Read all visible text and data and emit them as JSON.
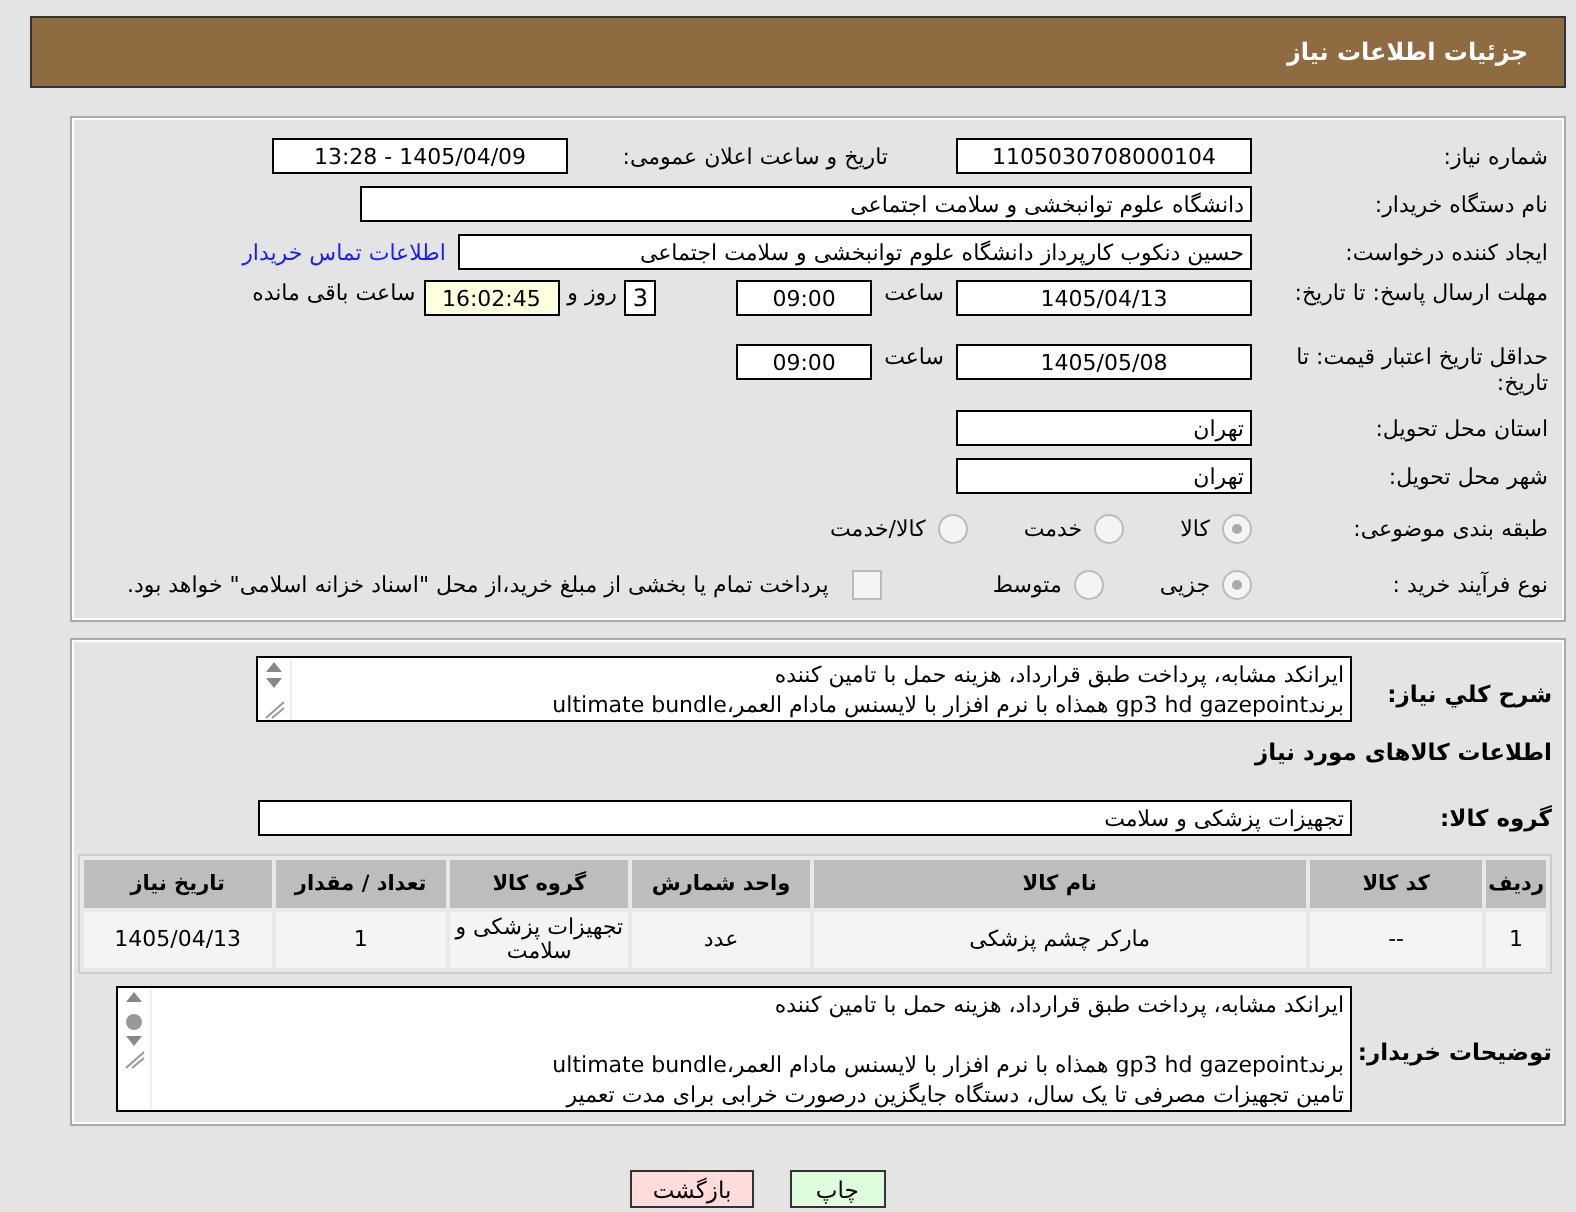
{
  "header": {
    "title": "جزئیات اطلاعات نیاز"
  },
  "need_number": {
    "label": "شماره نیاز:",
    "value": "1105030708000104"
  },
  "announce": {
    "label": "تاریخ و ساعت اعلان عمومی:",
    "value": "1405/04/09 - 13:28"
  },
  "buyer_org": {
    "label": "نام دستگاه خریدار:",
    "value": "دانشگاه علوم توانبخشی و سلامت اجتماعی"
  },
  "requester": {
    "label": "ایجاد کننده درخواست:",
    "value": "حسین دنکوب کارپرداز دانشگاه علوم توانبخشی و سلامت اجتماعی",
    "link": "اطلاعات تماس خریدار"
  },
  "response_deadline": {
    "label": "مهلت ارسال پاسخ: تا تاریخ:",
    "date": "1405/04/13",
    "time_label": "ساعت",
    "time": "09:00",
    "days": "3",
    "days_label": "روز و",
    "remaining": "16:02:45",
    "remaining_label": "ساعت باقی مانده"
  },
  "price_validity": {
    "label": "حداقل تاریخ اعتبار قیمت: تا تاریخ:",
    "date": "1405/05/08",
    "time_label": "ساعت",
    "time": "09:00"
  },
  "province": {
    "label": "استان محل تحویل:",
    "value": "تهران"
  },
  "city": {
    "label": "شهر محل تحویل:",
    "value": "تهران"
  },
  "category": {
    "label": "طبقه بندی موضوعی:",
    "options": [
      {
        "label": "کالا",
        "selected": true
      },
      {
        "label": "خدمت",
        "selected": false
      },
      {
        "label": "کالا/خدمت",
        "selected": false
      }
    ]
  },
  "process": {
    "label": "نوع فرآیند خرید :",
    "options": [
      {
        "label": "جزیی",
        "selected": true
      },
      {
        "label": "متوسط",
        "selected": false
      }
    ],
    "payment": {
      "label": "پرداخت تمام یا بخشی از مبلغ خرید،از محل \"اسناد خزانه اسلامی\" خواهد بود.",
      "checked": false
    }
  },
  "description": {
    "label": "شرح کلي نياز:",
    "lines": [
      "ایرانکد مشابه، پرداخت طبق قرارداد، هزینه حمل با تامین کننده",
      "برندgp3 hd gazepoint همذاه با نرم افزار با لایسنس مادام العمر،ultimate bundle"
    ]
  },
  "goods_title": "اطلاعات کالاهای مورد نیاز",
  "goods_group": {
    "label": "گروه کالا:",
    "value": "تجهیزات پزشکی و سلامت"
  },
  "table": {
    "columns": [
      "ردیف",
      "کد کالا",
      "نام کالا",
      "واحد شمارش",
      "گروه کالا",
      "تعداد / مقدار",
      "تاریخ نیاز"
    ],
    "rows": [
      [
        "1",
        "--",
        "مارکر چشم پزشکی",
        "عدد",
        "تجهیزات پزشکی و سلامت",
        "1",
        "1405/04/13"
      ]
    ]
  },
  "buyer_notes": {
    "label": "توضیحات خریدار:",
    "paragraphs": [
      {
        "lines": [
          "ایرانکد مشابه، پرداخت طبق قرارداد، هزینه حمل با تامین کننده"
        ]
      },
      {
        "lines": [
          "برندgp3 hd gazepoint همذاه با نرم افزار با لایسنس مادام العمر،ultimate bundle",
          "تامین تجهیزات مصرفی تا یک سال، دستگاه جایگزین درصورت خرابی برای مدت تعمیر"
        ]
      }
    ]
  },
  "buttons": [
    {
      "label": "چاپ",
      "kind": "print"
    },
    {
      "label": "بازگشت",
      "kind": "back"
    }
  ]
}
